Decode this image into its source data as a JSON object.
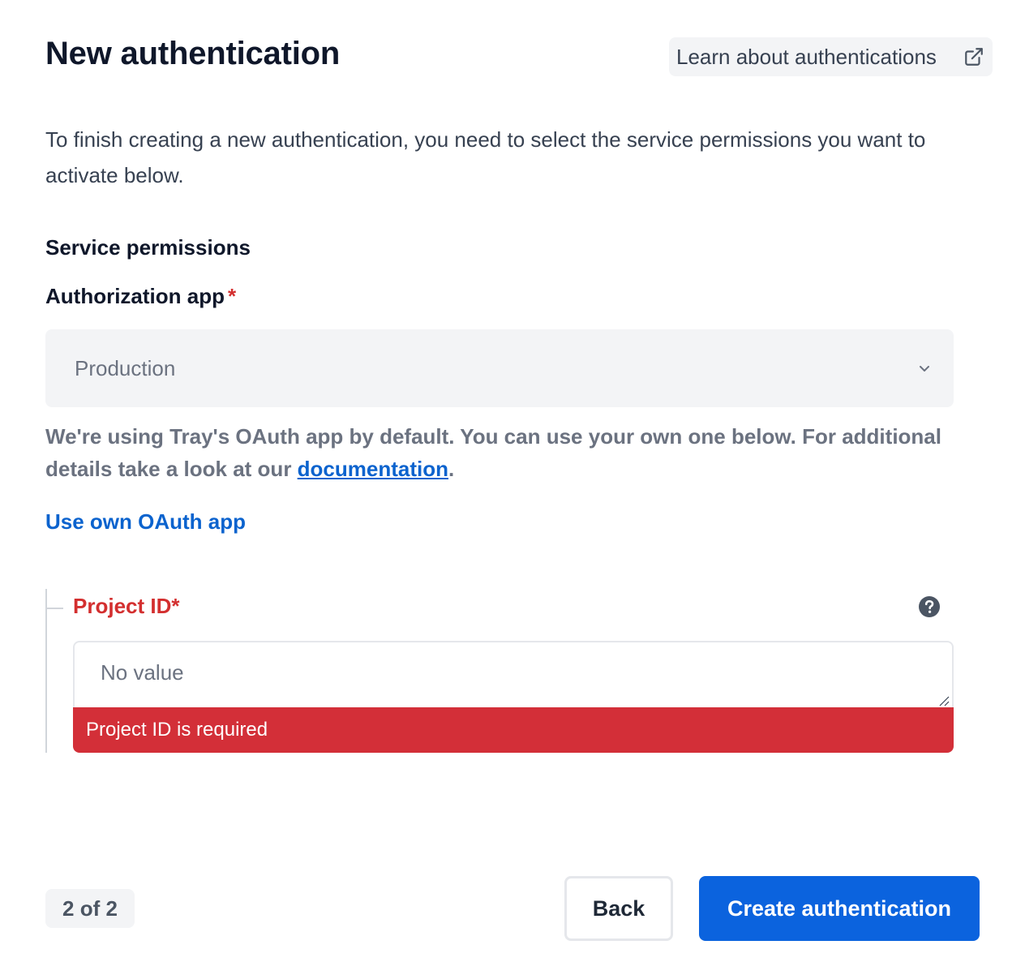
{
  "header": {
    "title": "New authentication",
    "learn_link": "Learn about authentications",
    "learn_icon": "external-link-icon"
  },
  "intro": "To finish creating a new authentication, you need to select the service permissions you want to activate below.",
  "service_permissions": {
    "section_title": "Service permissions",
    "authorization_app": {
      "label": "Authorization app",
      "required_marker": "*",
      "selected_value": "Production",
      "chevron_icon": "chevron-down-icon"
    },
    "help_text_prefix": "We're using Tray's OAuth app by default. You can use your own one below. For additional details take a look at our ",
    "help_text_link": "documentation",
    "help_text_suffix": ".",
    "own_app_link": "Use own OAuth app"
  },
  "project_id": {
    "label": "Project ID*",
    "placeholder": "No value",
    "value": "",
    "help_icon": "question-circle-icon",
    "error": "Project ID is required"
  },
  "footer": {
    "step": "2 of 2",
    "back_label": "Back",
    "create_label": "Create authentication"
  },
  "colors": {
    "primary": "#0b63de",
    "link": "#0b63ce",
    "error": "#d32f38",
    "muted_bg": "#f3f4f6",
    "heading": "#0f172a"
  }
}
